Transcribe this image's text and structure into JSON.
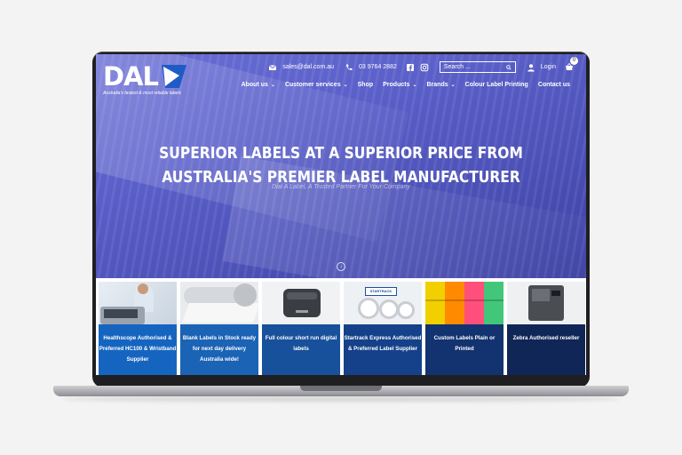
{
  "brand": {
    "logo_text": "DAL",
    "tagline": "Australia's fastest & most reliable labels"
  },
  "topbar": {
    "email": "sales@dal.com.au",
    "phone": "03 9764 2882",
    "search_placeholder": "Search ...",
    "login": "Login",
    "cart_count": "0"
  },
  "nav": {
    "items": [
      {
        "label": "About us",
        "dropdown": true
      },
      {
        "label": "Customer services",
        "dropdown": true
      },
      {
        "label": "Shop",
        "dropdown": false
      },
      {
        "label": "Products",
        "dropdown": true
      },
      {
        "label": "Brands",
        "dropdown": true
      },
      {
        "label": "Colour Label Printing",
        "dropdown": false
      },
      {
        "label": "Contact us",
        "dropdown": false
      }
    ]
  },
  "hero": {
    "headline_line1": "SUPERIOR LABELS AT A SUPERIOR PRICE FROM",
    "headline_line2": "AUSTRALIA'S PREMIER LABEL MANUFACTURER",
    "subline": "Dial A Label, A Trusted Partner For Your Company"
  },
  "tiles": [
    {
      "caption": "Healthscope Authorised & Preferred HC100 & Wristband Supplier",
      "color": "#1565c0"
    },
    {
      "caption": "Blank Labels in Stock ready for next day delivery Australia wide!",
      "color": "#1a63b5"
    },
    {
      "caption": "Full colour short run digital labels",
      "color": "#17519b"
    },
    {
      "caption": "Startrack Express Authorised & Preferred Label Supplier",
      "color": "#14418a"
    },
    {
      "caption": "Custom Labels Plain or Printed",
      "color": "#12336f"
    },
    {
      "caption": "Zebra Authorised reseller",
      "color": "#0f2657"
    }
  ],
  "startrack_logo": "STARTRACK"
}
